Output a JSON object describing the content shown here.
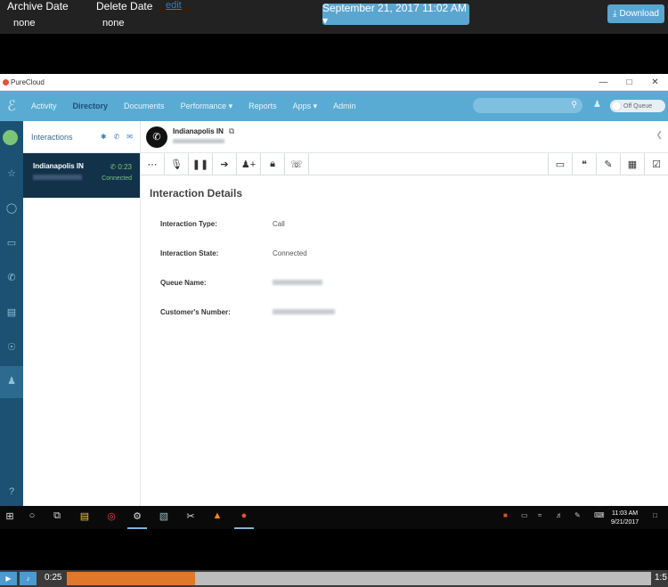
{
  "player_top": {
    "archive_label": "Archive Date",
    "archive_value": "none",
    "delete_label": "Delete Date",
    "delete_value": "none",
    "edit_link": "edit",
    "date_button": "September 21, 2017 11:02 AM ▾",
    "download_button": "Download"
  },
  "window": {
    "app_title": "PureCloud",
    "controls": [
      "—",
      "□",
      "✕"
    ]
  },
  "nav": {
    "items": [
      {
        "label": "Activity"
      },
      {
        "label": "Directory"
      },
      {
        "label": "Documents"
      },
      {
        "label": "Performance ▾"
      },
      {
        "label": "Reports"
      },
      {
        "label": "Apps ▾"
      },
      {
        "label": "Admin"
      }
    ],
    "queue_toggle": "Off Queue"
  },
  "interactions": {
    "header": "Interactions",
    "card": {
      "title": "Indianapolis IN",
      "time": "0:23",
      "status": "Connected"
    }
  },
  "detail": {
    "contact_name": "Indianapolis IN",
    "section_title": "Interaction Details",
    "rows": [
      {
        "label": "Interaction Type:",
        "value": "Call"
      },
      {
        "label": "Interaction State:",
        "value": "Connected"
      },
      {
        "label": "Queue Name:",
        "value": ""
      },
      {
        "label": "Customer's Number:",
        "value": ""
      }
    ]
  },
  "taskbar": {
    "clock_time": "11:03 AM",
    "clock_date": "9/21/2017"
  },
  "player_bottom": {
    "current_time": "0:25",
    "total_time": "1:5",
    "progress": 0.22
  },
  "colors": {
    "nav_bg": "#5aabd3",
    "rail_bg": "#1c5174",
    "card_bg": "#12324a",
    "status_green": "#7cc576",
    "progress_fill": "#e0782c"
  }
}
